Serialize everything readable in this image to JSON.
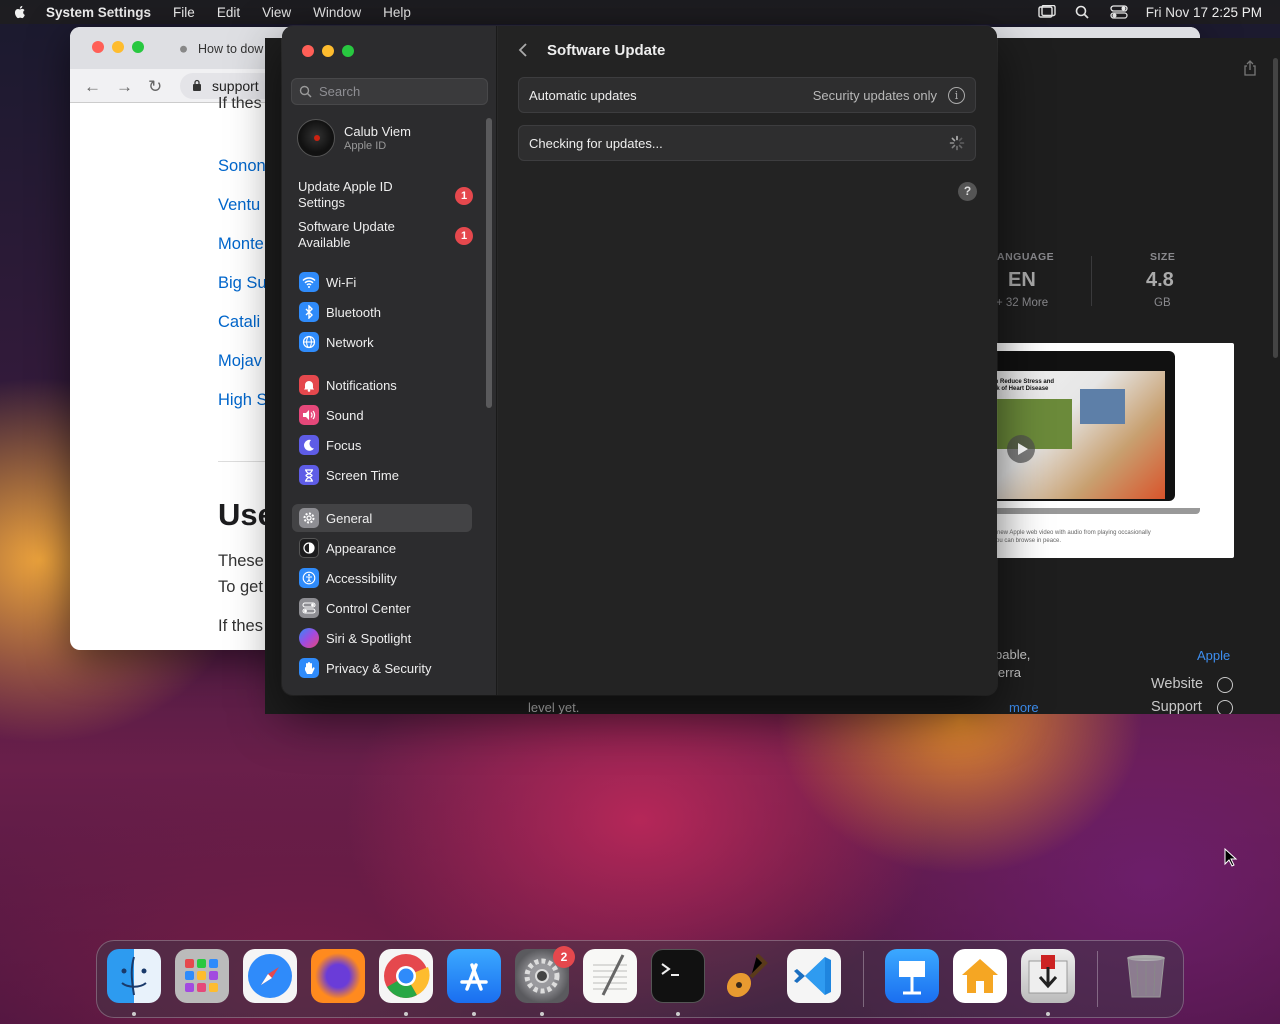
{
  "menubar": {
    "app_name": "System Settings",
    "items": [
      "File",
      "Edit",
      "View",
      "Window",
      "Help"
    ],
    "datetime": "Fri Nov 17  2:25 PM"
  },
  "browser": {
    "tab_title": "How to dow",
    "url": "support",
    "top_text": "If thes",
    "links": [
      "Sonon",
      "Ventu",
      "Monte",
      "Big Su",
      "Catali",
      "Mojav",
      "High S"
    ],
    "heading": "Use",
    "para1": "These",
    "para2": "To get",
    "para3": "If thes"
  },
  "appstore": {
    "language_label": "ANGUAGE",
    "language_value": "EN",
    "language_sub": "+ 32 More",
    "size_label": "SIZE",
    "size_value": "4.8",
    "size_unit": "GB",
    "caption": "The new Apple web video with audio from playing occasionally so you can browse in peace.",
    "desc1": "pable,",
    "desc2": "ierra",
    "desc_more": "more",
    "footer_text": "level yet.",
    "developer_link": "Apple",
    "website_label": "Website",
    "support_label": "Support",
    "shot_headline": "Can Reduce Stress and Risk of Heart Disease"
  },
  "settings": {
    "search_placeholder": "Search",
    "account_name": "Calub Viem",
    "account_sub": "Apple ID",
    "notices": [
      {
        "label": "Update Apple ID Settings",
        "badge": "1"
      },
      {
        "label": "Software Update Available",
        "badge": "1"
      }
    ],
    "sidebar_items": [
      {
        "label": "Wi-Fi",
        "icon": "wifi-icon",
        "color": "#2f8bfa"
      },
      {
        "label": "Bluetooth",
        "icon": "bluetooth-icon",
        "color": "#2f8bfa"
      },
      {
        "label": "Network",
        "icon": "globe-icon",
        "color": "#2f8bfa"
      },
      {
        "label": "Notifications",
        "icon": "bell-icon",
        "color": "#e5484d"
      },
      {
        "label": "Sound",
        "icon": "speaker-icon",
        "color": "#e5487a"
      },
      {
        "label": "Focus",
        "icon": "moon-icon",
        "color": "#5e5ce6"
      },
      {
        "label": "Screen Time",
        "icon": "hourglass-icon",
        "color": "#5e5ce6"
      },
      {
        "label": "General",
        "icon": "gear-icon",
        "color": "#8e8e93"
      },
      {
        "label": "Appearance",
        "icon": "appearance-icon",
        "color": "#1c1c1e"
      },
      {
        "label": "Accessibility",
        "icon": "accessibility-icon",
        "color": "#2f8bfa"
      },
      {
        "label": "Control Center",
        "icon": "control-center-icon",
        "color": "#8e8e93"
      },
      {
        "label": "Siri & Spotlight",
        "icon": "siri-icon",
        "color": "#a24ae0"
      },
      {
        "label": "Privacy & Security",
        "icon": "hand-icon",
        "color": "#2f8bfa"
      }
    ],
    "selected": "General",
    "page_title": "Software Update",
    "auto_updates_label": "Automatic updates",
    "auto_updates_value": "Security updates only",
    "checking_label": "Checking for updates...",
    "help_label": "?"
  },
  "dock": {
    "apps": [
      "Finder",
      "Launchpad",
      "Safari",
      "Firefox",
      "Chrome",
      "App Store",
      "System Settings",
      "TextEdit",
      "Terminal",
      "GarageBand",
      "Visual Studio Code",
      "Keynote",
      "Home",
      "Installer",
      "Trash"
    ],
    "settings_badge": "2"
  },
  "colors": {
    "accent": "#2f8bfa",
    "badge": "#e5484d",
    "link": "#0066cc"
  }
}
